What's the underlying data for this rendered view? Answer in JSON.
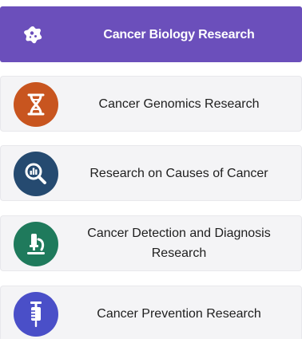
{
  "menu": {
    "items": [
      {
        "label": "Cancer Biology Research",
        "icon": "cancer-cell-icon",
        "active": true
      },
      {
        "label": "Cancer Genomics Research",
        "icon": "dna-icon",
        "color": "#c8551f"
      },
      {
        "label": "Research on Causes of Cancer",
        "icon": "magnify-chart-icon",
        "color": "#254a70"
      },
      {
        "label": "Cancer Detection and Diagnosis Research",
        "icon": "microscope-icon",
        "color": "#1f7a5c"
      },
      {
        "label": "Cancer Prevention Research",
        "icon": "syringe-icon",
        "color": "#4a4fc8"
      }
    ]
  },
  "colors": {
    "active_background": "#6b4fbb",
    "item_background": "#f4f4f6"
  }
}
